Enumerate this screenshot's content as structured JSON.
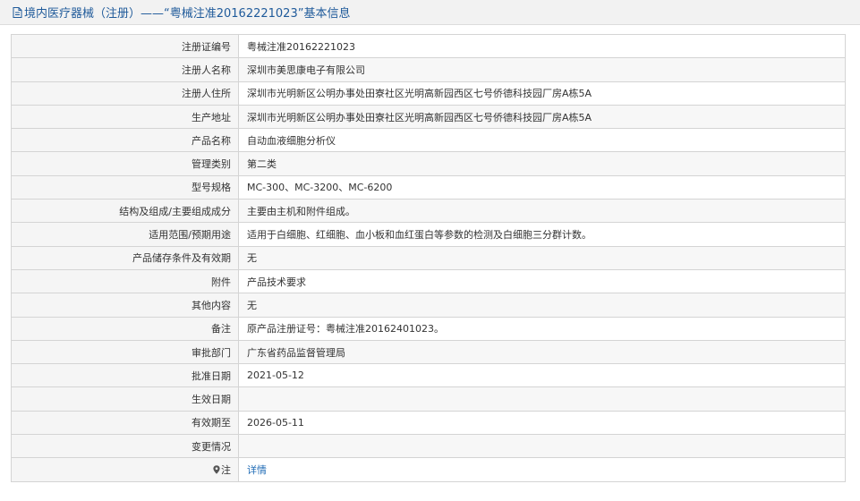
{
  "header": {
    "title": "境内医疗器械（注册）——“粤械注准20162221023”基本信息",
    "icon": "document-icon"
  },
  "rows": [
    {
      "label": "注册证编号",
      "value": "粤械注准20162221023"
    },
    {
      "label": "注册人名称",
      "value": "深圳市美思康电子有限公司"
    },
    {
      "label": "注册人住所",
      "value": "深圳市光明新区公明办事处田寮社区光明高新园西区七号侨德科技园厂房A栋5A"
    },
    {
      "label": "生产地址",
      "value": "深圳市光明新区公明办事处田寮社区光明高新园西区七号侨德科技园厂房A栋5A"
    },
    {
      "label": "产品名称",
      "value": "自动血液细胞分析仪"
    },
    {
      "label": "管理类别",
      "value": "第二类"
    },
    {
      "label": "型号规格",
      "value": "MC-300、MC-3200、MC-6200"
    },
    {
      "label": "结构及组成/主要组成成分",
      "value": "主要由主机和附件组成。"
    },
    {
      "label": "适用范围/预期用途",
      "value": "适用于白细胞、红细胞、血小板和血红蛋白等参数的检测及白细胞三分群计数。"
    },
    {
      "label": "产品储存条件及有效期",
      "value": "无"
    },
    {
      "label": "附件",
      "value": "产品技术要求"
    },
    {
      "label": "其他内容",
      "value": "无"
    },
    {
      "label": "备注",
      "value": "原产品注册证号：粤械注准20162401023。"
    },
    {
      "label": "审批部门",
      "value": "广东省药品监督管理局"
    },
    {
      "label": "批准日期",
      "value": "2021-05-12"
    },
    {
      "label": "生效日期",
      "value": ""
    },
    {
      "label": "有效期至",
      "value": "2026-05-11"
    },
    {
      "label": "变更情况",
      "value": ""
    }
  ],
  "note_row": {
    "label": "注",
    "icon": "map-pin-icon",
    "link_text": "详情"
  },
  "colors": {
    "title_text": "#1f5a9a",
    "link": "#1f6bb5",
    "border": "#d4d4d4",
    "label_bg": "#f5f5f5"
  }
}
